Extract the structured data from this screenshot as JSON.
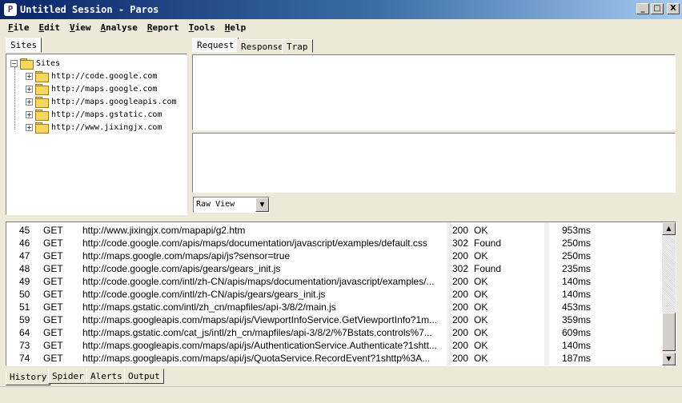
{
  "window": {
    "title": "Untitled Session - Paros",
    "app_icon_glyph": "P",
    "minimize": "_",
    "maximize": "□",
    "close": "X"
  },
  "menu": [
    {
      "key": "F",
      "rest": "ile"
    },
    {
      "key": "E",
      "rest": "dit"
    },
    {
      "key": "V",
      "rest": "iew"
    },
    {
      "key": "A",
      "rest": "nalyse"
    },
    {
      "key": "R",
      "rest": "eport"
    },
    {
      "key": "T",
      "rest": "ools"
    },
    {
      "key": "H",
      "rest": "elp"
    }
  ],
  "sites": {
    "tab_label": "Sites",
    "root_label": "Sites",
    "children": [
      "http://code.google.com",
      "http://maps.google.com",
      "http://maps.googleapis.com",
      "http://maps.gstatic.com",
      "http://www.jixingjx.com"
    ]
  },
  "request_tabs": [
    "Request",
    "Response",
    "Trap"
  ],
  "view_select": {
    "value": "Raw View"
  },
  "history_rows": [
    {
      "id": "45",
      "method": "GET",
      "url": "http://www.jixingjx.com/mapapi/g2.htm",
      "code": "200",
      "reason": "OK",
      "time": "953ms"
    },
    {
      "id": "46",
      "method": "GET",
      "url": "http://code.google.com/apis/maps/documentation/javascript/examples/default.css",
      "code": "302",
      "reason": "Found",
      "time": "250ms"
    },
    {
      "id": "47",
      "method": "GET",
      "url": "http://maps.google.com/maps/api/js?sensor=true",
      "code": "200",
      "reason": "OK",
      "time": "250ms"
    },
    {
      "id": "48",
      "method": "GET",
      "url": "http://code.google.com/apis/gears/gears_init.js",
      "code": "302",
      "reason": "Found",
      "time": "235ms"
    },
    {
      "id": "49",
      "method": "GET",
      "url": "http://code.google.com/intl/zh-CN/apis/maps/documentation/javascript/examples/...",
      "code": "200",
      "reason": "OK",
      "time": "140ms"
    },
    {
      "id": "50",
      "method": "GET",
      "url": "http://code.google.com/intl/zh-CN/apis/gears/gears_init.js",
      "code": "200",
      "reason": "OK",
      "time": "140ms"
    },
    {
      "id": "51",
      "method": "GET",
      "url": "http://maps.gstatic.com/intl/zh_cn/mapfiles/api-3/8/2/main.js",
      "code": "200",
      "reason": "OK",
      "time": "453ms"
    },
    {
      "id": "59",
      "method": "GET",
      "url": "http://maps.googleapis.com/maps/api/js/ViewportInfoService.GetViewportInfo?1m...",
      "code": "200",
      "reason": "OK",
      "time": "359ms"
    },
    {
      "id": "64",
      "method": "GET",
      "url": "http://maps.gstatic.com/cat_js/intl/zh_cn/mapfiles/api-3/8/2/%7Bstats,controls%7...",
      "code": "200",
      "reason": "OK",
      "time": "609ms"
    },
    {
      "id": "73",
      "method": "GET",
      "url": "http://maps.googleapis.com/maps/api/js/AuthenticationService.Authenticate?1shtt...",
      "code": "200",
      "reason": "OK",
      "time": "140ms"
    },
    {
      "id": "74",
      "method": "GET",
      "url": "http://maps.googleapis.com/maps/api/js/QuotaService.RecordEvent?1shttp%3A...",
      "code": "200",
      "reason": "OK",
      "time": "187ms"
    }
  ],
  "bottom_tabs": [
    "History",
    "Spider",
    "Alerts",
    "Output"
  ],
  "scroll": {
    "up": "▲",
    "down": "▼"
  }
}
